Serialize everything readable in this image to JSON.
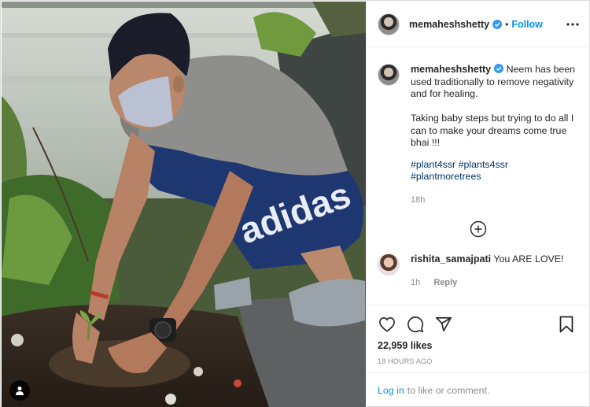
{
  "post": {
    "username": "memaheshshetty",
    "follow_label": "Follow",
    "dot": "•",
    "caption": "Neem has been used traditionally to remove negativity and for healing.\n\nTaking baby steps but trying to do all I can to make your dreams come true bhai !!!",
    "hashtags": [
      "#plant4ssr",
      "#plants4ssr",
      "#plantmoretrees"
    ],
    "caption_time": "18h"
  },
  "comments": [
    {
      "username": "rishita_samajpati",
      "text": "You ARE LOVE!",
      "time": "1h",
      "reply_label": "Reply"
    }
  ],
  "stats": {
    "likes": "22,959 likes",
    "posted": "18 HOURS AGO"
  },
  "login": {
    "link_label": "Log in",
    "suffix": "to like or comment."
  },
  "icons": {
    "verified": "verified-badge-icon",
    "more": "more-options-icon",
    "load_more": "plus-circle-icon",
    "like": "heart-icon",
    "comment": "comment-bubble-icon",
    "share": "paper-plane-icon",
    "save": "bookmark-icon",
    "user_tag": "user-tag-icon"
  },
  "colors": {
    "accent": "#0095f6",
    "verified": "#3897f0",
    "hashtag": "#00376b",
    "muted": "#8e8e8e",
    "text": "#262626"
  }
}
